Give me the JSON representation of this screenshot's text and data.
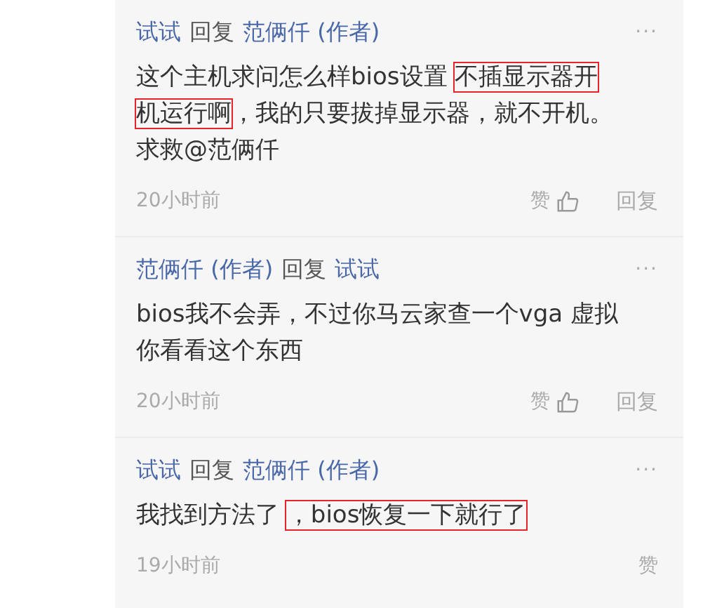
{
  "comments": [
    {
      "author": "试试",
      "reply_word": "回复",
      "target": "范俩仟 (作者)",
      "more": "···",
      "lines": [
        [
          {
            "text": "这个主机求问怎么样bios设置 ",
            "highlighted": false
          },
          {
            "text": "不插显示器开",
            "highlighted": true
          }
        ],
        [
          {
            "text": "机运行啊",
            "highlighted": true
          },
          {
            "text": "，我的只要拔掉显示器，就不开机。",
            "highlighted": false
          }
        ],
        [
          {
            "text": "求救@范俩仟",
            "highlighted": false
          }
        ]
      ],
      "time": "20小时前",
      "like": "赞",
      "reply": "回复",
      "like_icon": true
    },
    {
      "author": "范俩仟 (作者)",
      "reply_word": "回复",
      "target": "试试",
      "more": "···",
      "lines": [
        [
          {
            "text": "bios我不会弄，不过你马云家查一个vga 虚拟",
            "highlighted": false
          }
        ],
        [
          {
            "text": "你看看这个东西",
            "highlighted": false
          }
        ]
      ],
      "time": "20小时前",
      "like": "赞",
      "reply": "回复",
      "like_icon": true
    },
    {
      "author": "试试",
      "reply_word": "回复",
      "target": "范俩仟 (作者)",
      "more": "···",
      "lines": [
        [
          {
            "text": "我找到方法了 ",
            "highlighted": false
          },
          {
            "text": "，bios恢复一下就行了",
            "highlighted": true
          }
        ]
      ],
      "time": "19小时前",
      "like": "赞",
      "like_icon": false
    }
  ]
}
